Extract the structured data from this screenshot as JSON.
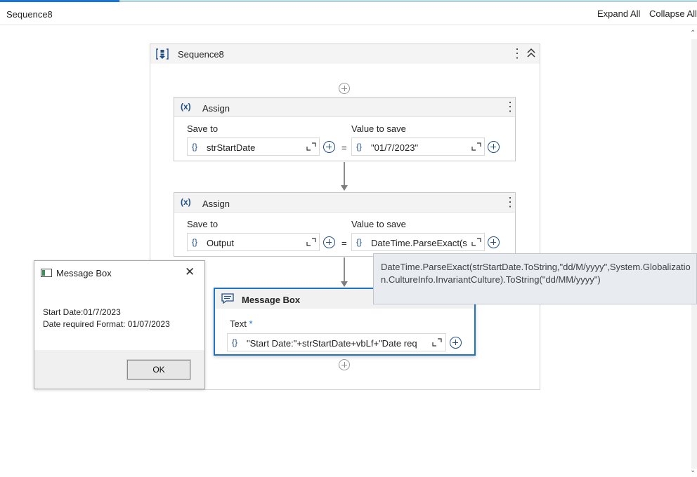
{
  "header": {
    "title": "Sequence8",
    "expand_all": "Expand All",
    "collapse_all": "Collapse All"
  },
  "sequence": {
    "title": "Sequence8",
    "icon": "sequence-icon"
  },
  "assigns": [
    {
      "name": "Assign",
      "save_to_label": "Save to",
      "value_label": "Value to save",
      "save_to_value": "strStartDate",
      "value": "\"01/7/2023\""
    },
    {
      "name": "Assign",
      "save_to_label": "Save to",
      "value_label": "Value to save",
      "save_to_value": "Output",
      "value": "DateTime.ParseExact(s"
    }
  ],
  "message_box_activity": {
    "title": "Message Box",
    "text_label": "Text",
    "required_mark": "*",
    "text_value": "\"Start Date:\"+strStartDate+vbLf+\"Date req"
  },
  "tooltip": {
    "text": "DateTime.ParseExact(strStartDate.ToString,\"dd/M/yyyy\",System.Globalization.CultureInfo.InvariantCulture).ToString(\"dd/MM/yyyy\")"
  },
  "dialog": {
    "title": "Message Box",
    "line1": "Start Date:01/7/2023",
    "line2": "Date required Format: 01/07/2023",
    "ok_label": "OK"
  },
  "colors": {
    "accent": "#1976d2",
    "expression_blue": "#1f4f86",
    "selected_border": "#1f73c5",
    "tooltip_bg": "#e8ecf1"
  }
}
